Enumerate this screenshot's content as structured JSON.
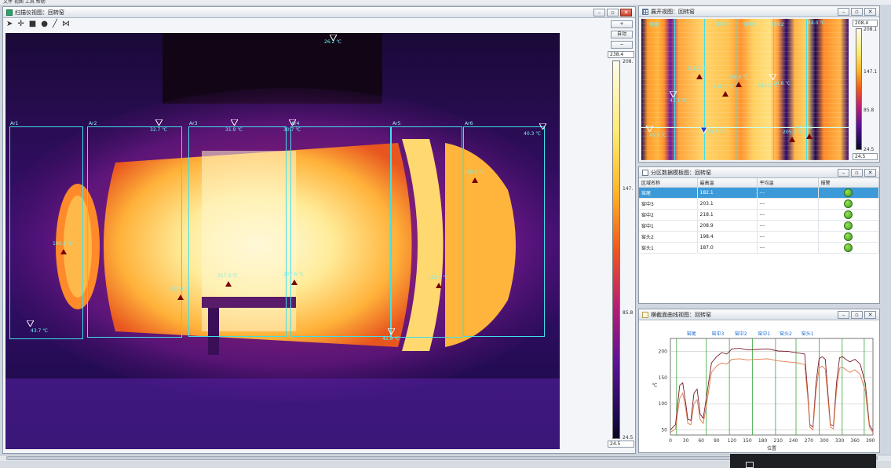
{
  "topstrip": {
    "text": "文件 视图 工具 帮助"
  },
  "main_window": {
    "title": "扫描仪视图：回转窑",
    "toolbar_icons": [
      "cursor-icon",
      "crosshair-icon",
      "rectangle-icon",
      "ellipse-icon",
      "line-icon",
      "polyline-icon"
    ],
    "zones": [
      {
        "label": "Ar1"
      },
      {
        "label": "Ar2"
      },
      {
        "label": "Ar3"
      },
      {
        "label": "Ar4"
      },
      {
        "label": "Ar5"
      },
      {
        "label": "Ar6"
      }
    ],
    "temp_labels": {
      "top": "26.2 ℃",
      "ar2_min": "32.7 ℃",
      "ar3_min": "31.9 ℃",
      "ar4_min": "30.7 ℃",
      "ar6_min": "40.3 ℃",
      "ar1_max": "190.2 ℃",
      "ar2_max": "201.0 ℃",
      "ar3_max": "217.3 ℃",
      "ar4_max": "207.6 ℃",
      "ar5_max": "193.5 ℃",
      "ar6_max": "199.0 ℃",
      "ar1_min": "43.7 ℃",
      "ar5_min": "42.6 ℃"
    },
    "side_buttons": {
      "plus": "+",
      "auto": "自动",
      "minus": "−"
    },
    "colorbar": {
      "max_value": "238.4",
      "top_tick": "208.",
      "mid_tick": "147.",
      "low_tick": "85.8",
      "bottom_tick": "24.5",
      "min_value": "24.5"
    },
    "colors": {
      "cyan": "#3fe0ea",
      "marker": "#7a0000"
    }
  },
  "strip_window": {
    "title": "展开视图：回转窑",
    "labels": {
      "top_left": "窑尾",
      "z1": "窑中3",
      "z2": "窑中2",
      "z3": "窑头2",
      "hot": "217.3 ℃",
      "peak": "210.1 ℃",
      "max2": "208.6 ℃",
      "max3": "193.5 ℃",
      "max4": "205.2 ℃",
      "cold1": "43.1 ℃",
      "cold2": "45.8 ℃",
      "cold3": "26.7 ℃",
      "cold4": "42.3 ℃",
      "cold5": "70.6 ℃",
      "edge": "44.0 ℃"
    },
    "colorbar": {
      "max_value": "208.4",
      "top_tick": "208.1",
      "mid_tick": "147.1",
      "low_tick": "85.8",
      "bottom_tick": "24.5",
      "min_value": "24.5"
    }
  },
  "table_window": {
    "title": "分区数据模板图：回转窑",
    "columns": [
      "区域名称",
      "最高温",
      "平均温",
      "报警"
    ],
    "rows": [
      {
        "name": "窑尾",
        "max": "182.1",
        "avg": "---",
        "selected": true
      },
      {
        "name": "窑中3",
        "max": "203.1",
        "avg": "---",
        "selected": false
      },
      {
        "name": "窑中2",
        "max": "218.1",
        "avg": "---",
        "selected": false
      },
      {
        "name": "窑中1",
        "max": "208.9",
        "avg": "---",
        "selected": false
      },
      {
        "name": "窑头2",
        "max": "198.4",
        "avg": "---",
        "selected": false
      },
      {
        "name": "窑头1",
        "max": "187.0",
        "avg": "---",
        "selected": false
      }
    ]
  },
  "curve_window": {
    "title": "横截面曲线视图：回转窑",
    "chart_data": {
      "type": "line",
      "zone_labels": [
        "窑尾",
        "窑中3",
        "窑中2",
        "窑中1",
        "窑头2",
        "窑头1"
      ],
      "x_ticks": [
        "0",
        "30",
        "60",
        "90",
        "120",
        "150",
        "180",
        "210",
        "240",
        "270",
        "300",
        "330",
        "360",
        "390"
      ],
      "y_ticks": [
        "200",
        "150",
        "100",
        "50"
      ],
      "xlabel": "位置",
      "ylabel": "℃",
      "xlim": [
        0,
        395
      ],
      "ylim": [
        40,
        225
      ],
      "zone_boundaries": [
        12,
        70,
        115,
        160,
        205,
        245,
        290,
        335,
        378
      ],
      "series": [
        {
          "values": [
            [
              0,
              50
            ],
            [
              10,
              60
            ],
            [
              18,
              135
            ],
            [
              24,
              140
            ],
            [
              30,
              100
            ],
            [
              34,
              70
            ],
            [
              40,
              68
            ],
            [
              46,
              120
            ],
            [
              52,
              128
            ],
            [
              58,
              80
            ],
            [
              64,
              72
            ],
            [
              70,
              110
            ],
            [
              80,
              178
            ],
            [
              90,
              190
            ],
            [
              100,
              198
            ],
            [
              110,
              195
            ],
            [
              120,
              205
            ],
            [
              135,
              206
            ],
            [
              150,
              203
            ],
            [
              170,
              204
            ],
            [
              190,
              205
            ],
            [
              210,
              201
            ],
            [
              230,
              200
            ],
            [
              250,
              197
            ],
            [
              262,
              195
            ],
            [
              268,
              120
            ],
            [
              272,
              60
            ],
            [
              278,
              55
            ],
            [
              284,
              140
            ],
            [
              290,
              186
            ],
            [
              296,
              190
            ],
            [
              302,
              185
            ],
            [
              308,
              110
            ],
            [
              312,
              60
            ],
            [
              318,
              58
            ],
            [
              324,
              140
            ],
            [
              330,
              188
            ],
            [
              336,
              190
            ],
            [
              342,
              185
            ],
            [
              350,
              180
            ],
            [
              360,
              185
            ],
            [
              370,
              176
            ],
            [
              380,
              140
            ],
            [
              388,
              60
            ],
            [
              395,
              48
            ]
          ]
        },
        {
          "values": [
            [
              0,
              45
            ],
            [
              10,
              52
            ],
            [
              18,
              110
            ],
            [
              24,
              120
            ],
            [
              30,
              90
            ],
            [
              34,
              62
            ],
            [
              40,
              60
            ],
            [
              46,
              100
            ],
            [
              52,
              108
            ],
            [
              58,
              70
            ],
            [
              64,
              62
            ],
            [
              70,
              95
            ],
            [
              80,
              160
            ],
            [
              90,
              172
            ],
            [
              100,
              178
            ],
            [
              110,
              176
            ],
            [
              120,
              185
            ],
            [
              135,
              186
            ],
            [
              150,
              184
            ],
            [
              170,
              185
            ],
            [
              190,
              186
            ],
            [
              210,
              182
            ],
            [
              230,
              180
            ],
            [
              250,
              178
            ],
            [
              262,
              175
            ],
            [
              268,
              110
            ],
            [
              272,
              55
            ],
            [
              278,
              50
            ],
            [
              284,
              125
            ],
            [
              290,
              168
            ],
            [
              296,
              172
            ],
            [
              302,
              166
            ],
            [
              308,
              100
            ],
            [
              312,
              55
            ],
            [
              318,
              52
            ],
            [
              324,
              125
            ],
            [
              330,
              168
            ],
            [
              336,
              170
            ],
            [
              342,
              165
            ],
            [
              350,
              160
            ],
            [
              360,
              165
            ],
            [
              370,
              156
            ],
            [
              380,
              125
            ],
            [
              388,
              55
            ],
            [
              395,
              44
            ]
          ]
        }
      ]
    }
  }
}
